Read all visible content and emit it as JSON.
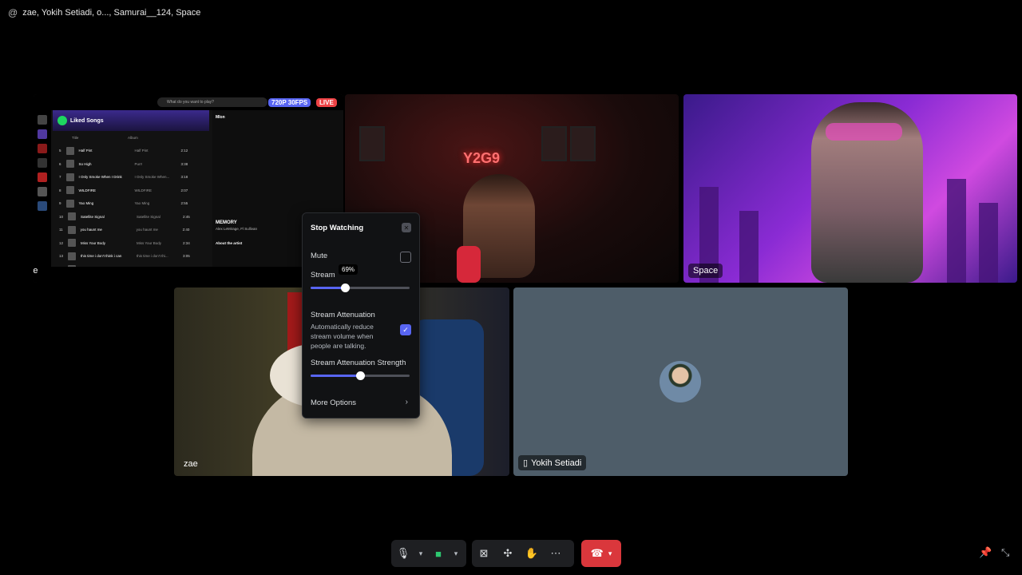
{
  "topbar": {
    "at_symbol": "@",
    "title": "zae, Yokih Setiadi, o..., Samurai__124, Space"
  },
  "stream_tile": {
    "participant": "zae",
    "resolution_badge": "720P 30FPS",
    "live_badge": "LIVE",
    "spotify": {
      "search_placeholder": "What do you want to play?",
      "playlist_title": "Liked Songs",
      "col_title": "Title",
      "col_album": "Album",
      "tracks": [
        {
          "num": "5",
          "title": "Half Pint",
          "album": "Half Pint",
          "dur": "2:12"
        },
        {
          "num": "6",
          "title": "So High",
          "album": "Purr!",
          "dur": "3:38"
        },
        {
          "num": "7",
          "title": "I Only Smoke When I Drink",
          "album": "I Only Smoke When...",
          "dur": "3:18"
        },
        {
          "num": "8",
          "title": "WILDFIRE",
          "album": "WILDFIRE",
          "dur": "2:07"
        },
        {
          "num": "9",
          "title": "Yao Ming",
          "album": "Yao Ming",
          "dur": "2:55"
        },
        {
          "num": "10",
          "title": "Satellite Signal",
          "album": "Satellite Signal",
          "dur": "2:45"
        },
        {
          "num": "11",
          "title": "you haunt me",
          "album": "you haunt me",
          "dur": "2:40"
        },
        {
          "num": "12",
          "title": "Miss Your Body",
          "album": "Miss Your Body",
          "dur": "2:34"
        },
        {
          "num": "13",
          "title": "this time i don't think i can",
          "album": "this time i don't thi...",
          "dur": "3:05"
        },
        {
          "num": "14",
          "title": "WAYZU",
          "album": "",
          "dur": ""
        }
      ],
      "now_playing_title": "MEMORY",
      "now_playing_artist": "Alex LeMirage, Fl Sullivan",
      "about_artist": "About the artist",
      "right_header": "Mīon"
    }
  },
  "tiles": {
    "space_label": "Space",
    "zae_label": "zae",
    "yokih_label": "Yokih Setiadi"
  },
  "popup": {
    "stop_watching": "Stop Watching",
    "mute": "Mute",
    "stream_volume": "Stream",
    "stream_volume_pct": 69,
    "stream_volume_tip": "69%",
    "attenuation_title": "Stream Attenuation",
    "attenuation_desc": "Automatically reduce stream volume when people are talking.",
    "attenuation_checked": true,
    "strength_title": "Stream Attenuation Strength",
    "strength_pct": 50,
    "more_options": "More Options"
  },
  "controls": {
    "icons": [
      "microphone-icon",
      "camera-icon",
      "screen-share-stop-icon",
      "activities-icon",
      "soundboard-icon",
      "more-icon",
      "end-call-icon",
      "pin-icon",
      "exit-fullscreen-icon"
    ]
  },
  "colors": {
    "accent": "#5865f2",
    "danger": "#da373c",
    "live": "#ed4245",
    "spotify_green": "#1ed760"
  }
}
